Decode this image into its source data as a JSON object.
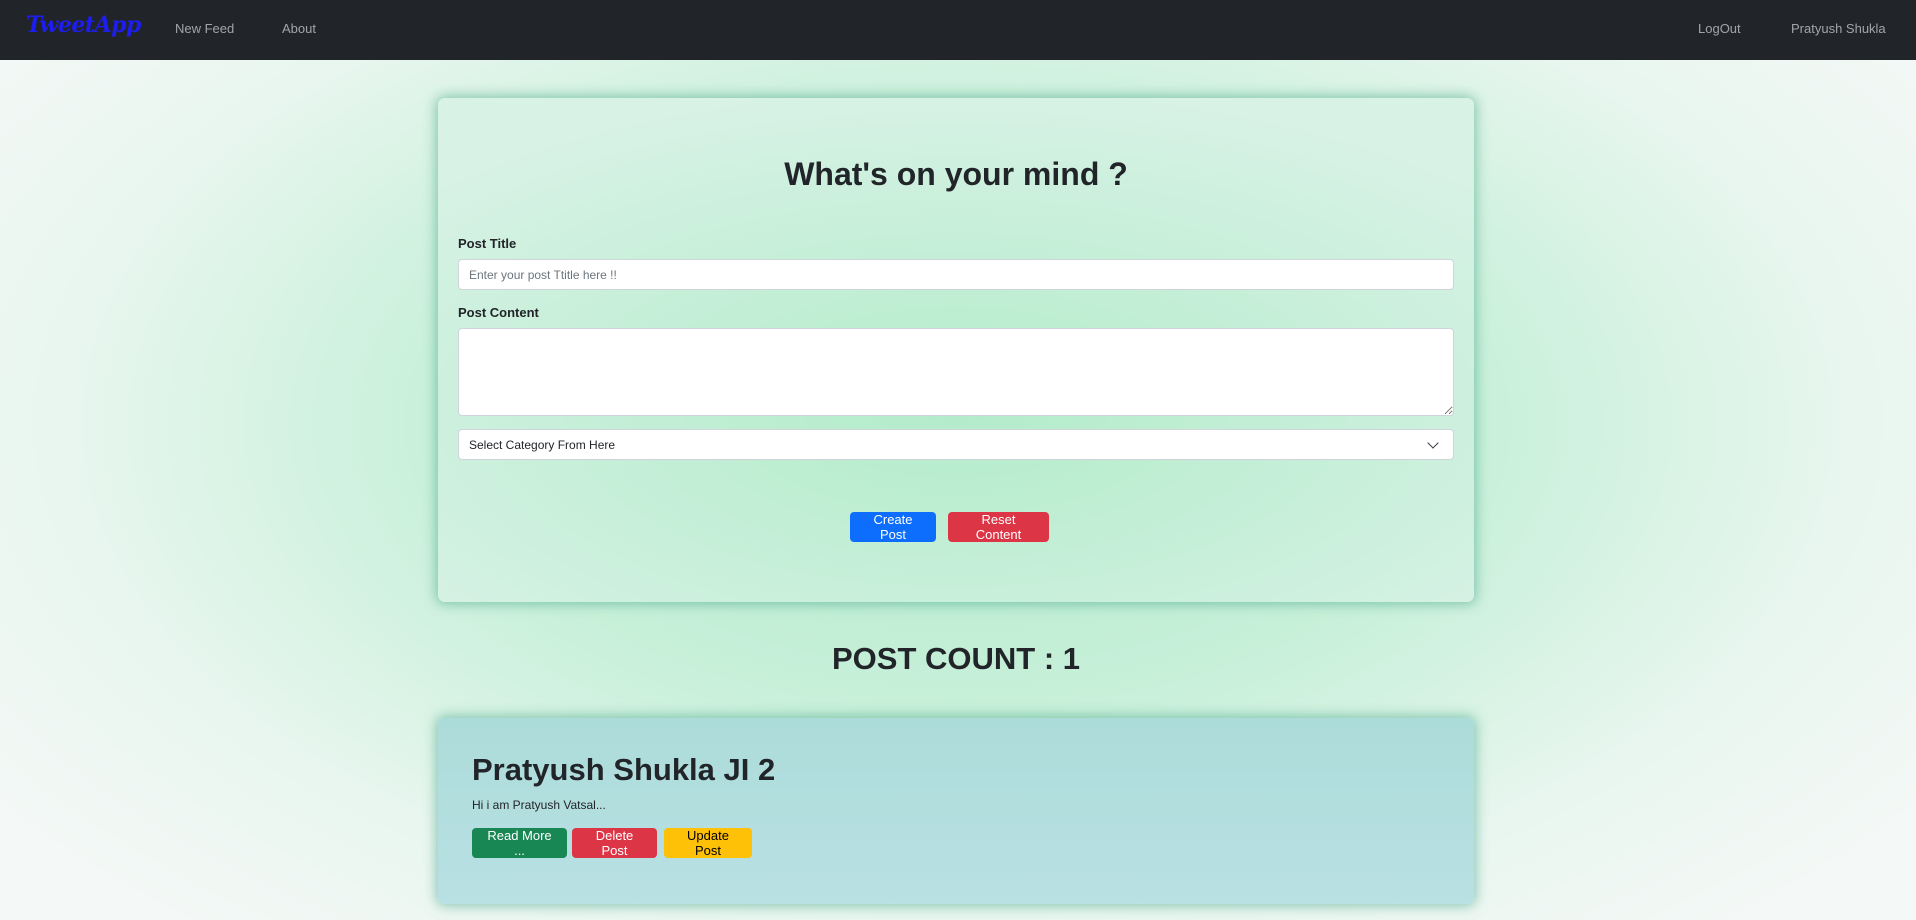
{
  "navbar": {
    "brand": "TweetApp",
    "links": {
      "new_feed": "New Feed",
      "about": "About",
      "logout": "LogOut",
      "user": "Pratyush Shukla"
    }
  },
  "create_form": {
    "heading": "What's on your mind ?",
    "title_label": "Post Title",
    "title_placeholder": "Enter your post Ttitle here !!",
    "content_label": "Post Content",
    "category_selected": "Select Category From Here",
    "create_button": "Create Post",
    "reset_button": "Reset Content"
  },
  "post_count": {
    "label": "POST COUNT : 1"
  },
  "post": {
    "title": "Pratyush Shukla JI 2",
    "excerpt": "Hi i am Pratyush Vatsal...",
    "read_more": "Read More ...",
    "delete": "Delete Post",
    "update": "Update Post"
  },
  "colors": {
    "navbar_bg": "#212529",
    "brand": "#1d1df0",
    "primary": "#0d6efd",
    "danger": "#dc3545",
    "success": "#198754",
    "warning": "#ffc107"
  }
}
